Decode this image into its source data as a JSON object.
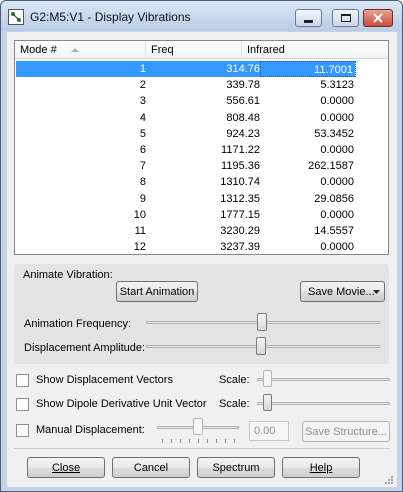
{
  "window": {
    "title": "G2:M5:V1 - Display Vibrations"
  },
  "list": {
    "columns": [
      "Mode #",
      "Freq",
      "Infrared"
    ],
    "rows": [
      {
        "mode": "1",
        "freq": "314.76",
        "ir": "11.7001"
      },
      {
        "mode": "2",
        "freq": "339.78",
        "ir": "5.3123"
      },
      {
        "mode": "3",
        "freq": "556.61",
        "ir": "0.0000"
      },
      {
        "mode": "4",
        "freq": "808.48",
        "ir": "0.0000"
      },
      {
        "mode": "5",
        "freq": "924.23",
        "ir": "53.3452"
      },
      {
        "mode": "6",
        "freq": "1171.22",
        "ir": "0.0000"
      },
      {
        "mode": "7",
        "freq": "1195.36",
        "ir": "262.1587"
      },
      {
        "mode": "8",
        "freq": "1310.74",
        "ir": "0.0000"
      },
      {
        "mode": "9",
        "freq": "1312.35",
        "ir": "29.0856"
      },
      {
        "mode": "10",
        "freq": "1777.15",
        "ir": "0.0000"
      },
      {
        "mode": "11",
        "freq": "3230.29",
        "ir": "14.5557"
      },
      {
        "mode": "12",
        "freq": "3237.39",
        "ir": "0.0000"
      }
    ],
    "selected_index": 0
  },
  "animate": {
    "group_label": "Animate Vibration:",
    "start_button": "Start Animation",
    "save_movie_button": "Save Movie...",
    "frequency_label": "Animation Frequency:",
    "amplitude_label": "Displacement Amplitude:",
    "frequency_level": 0.5,
    "amplitude_level": 0.5
  },
  "options": {
    "show_vectors_label": "Show Displacement Vectors",
    "show_dipole_label": "Show Dipole Derivative Unit Vector",
    "manual_label": "Manual Displacement:",
    "scale_label": "Scale:",
    "manual_value": "0.00",
    "save_structure_button": "Save Structure..."
  },
  "buttons": {
    "close": "Close",
    "cancel": "Cancel",
    "spectrum": "Spectrum",
    "help": "Help"
  }
}
